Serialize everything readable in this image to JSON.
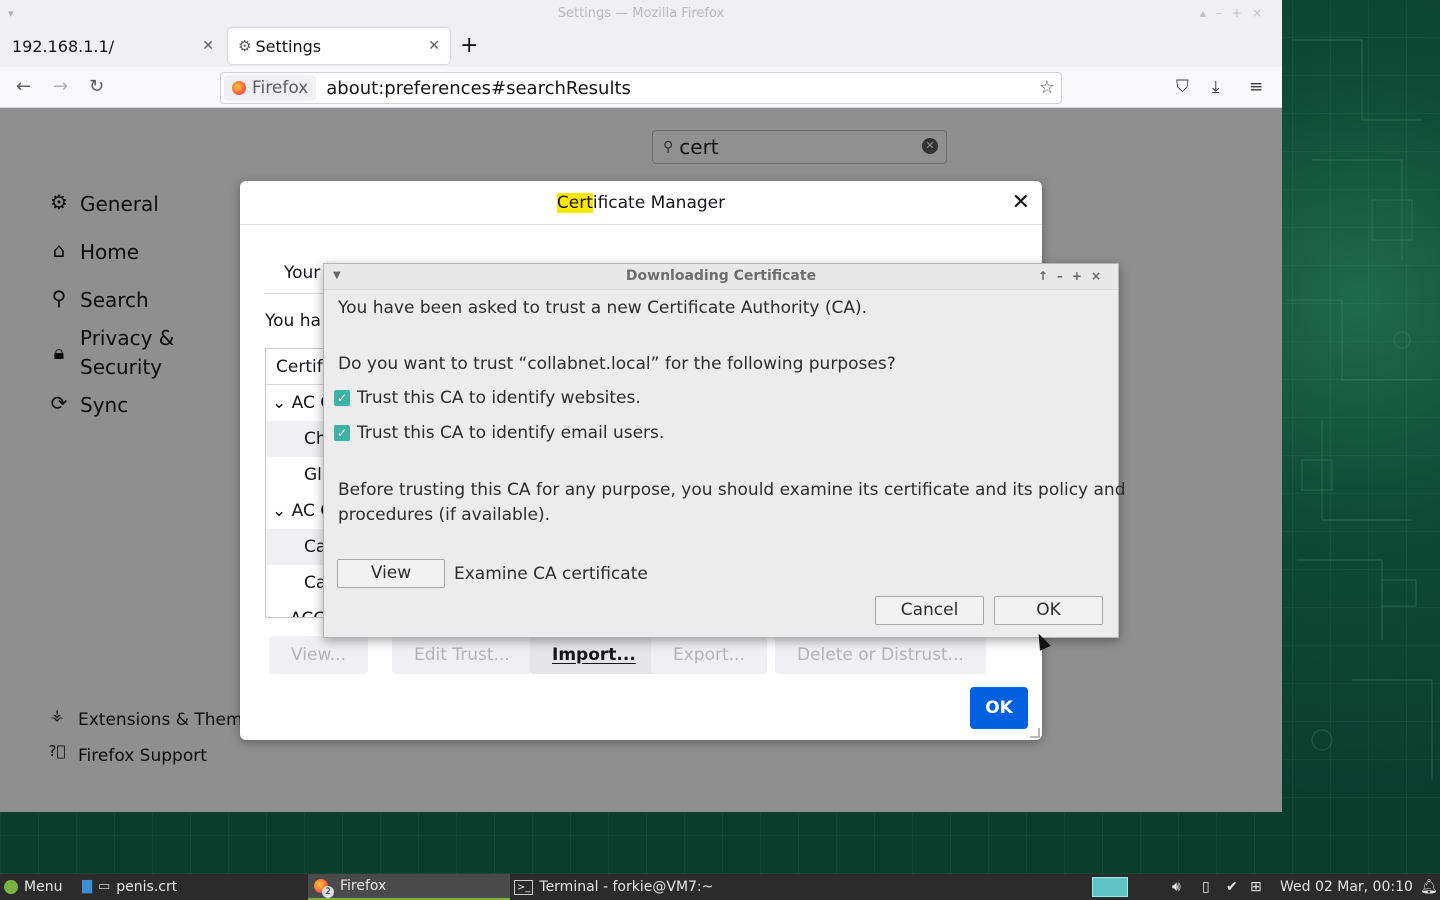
{
  "window": {
    "title": "Settings — Mozilla Firefox"
  },
  "tabs": [
    {
      "label": "192.168.1.1/"
    },
    {
      "label": "Settings"
    }
  ],
  "urlbar": {
    "identity_label": "Firefox",
    "url": "about:preferences#searchResults"
  },
  "prefs": {
    "search_value": "cert",
    "categories": [
      {
        "label": "General",
        "icon": "gear-icon"
      },
      {
        "label": "Home",
        "icon": "home-icon"
      },
      {
        "label": "Search",
        "icon": "search-icon"
      },
      {
        "label": "Privacy &",
        "label2": "Security",
        "icon": "lock-icon"
      },
      {
        "label": "Sync",
        "icon": "sync-icon"
      }
    ],
    "footer": [
      {
        "label": "Extensions & Themes",
        "icon": "puzzle-icon"
      },
      {
        "label": "Firefox Support",
        "icon": "help-icon"
      }
    ]
  },
  "cert_manager": {
    "title_highlight": "Cert",
    "title_rest": "ificate Manager",
    "tab_label": "Your",
    "desc": "You ha",
    "tree": {
      "header": "Certif",
      "rows": [
        {
          "type": "group",
          "label": "AC C"
        },
        {
          "type": "item",
          "label": "Ch"
        },
        {
          "type": "item",
          "label": "Gl"
        },
        {
          "type": "group",
          "label": "AC C"
        },
        {
          "type": "item",
          "label": "Ca"
        },
        {
          "type": "item",
          "label": "Ca"
        },
        {
          "type": "group",
          "label": "ACC"
        }
      ]
    },
    "buttons": {
      "view": "View...",
      "edit_trust": "Edit Trust...",
      "import": "Import...",
      "export": "Export...",
      "delete": "Delete or Distrust..."
    },
    "ok": "OK"
  },
  "dialog": {
    "title": "Downloading Certificate",
    "line1": "You have been asked to trust a new Certificate Authority (CA).",
    "line2": "Do you want to trust “collabnet.local” for the following purposes?",
    "check_websites": "Trust this CA to identify websites.",
    "check_email": "Trust this CA to identify email users.",
    "line3a": "Before trusting this CA for any purpose, you should examine its certificate and its policy and",
    "line3b": "procedures (if available).",
    "view_button": "View",
    "view_label": "Examine CA certificate",
    "cancel": "Cancel",
    "ok": "OK"
  },
  "taskbar": {
    "menu": "Menu",
    "file": "penis.crt",
    "firefox": "Firefox",
    "firefox_badge": "2",
    "terminal": "Terminal - forkie@VM7:~",
    "clock": "Wed 02 Mar, 00:10"
  }
}
